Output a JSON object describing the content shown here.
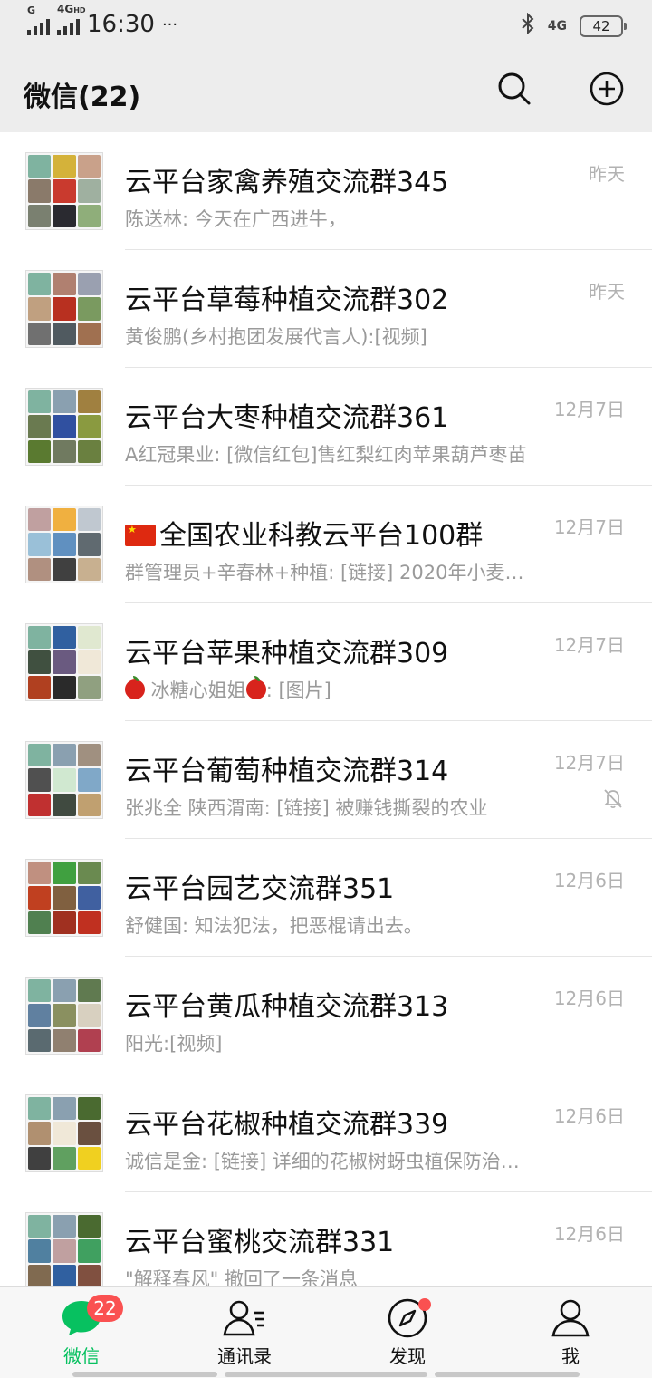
{
  "status_bar": {
    "signal_label": "G",
    "net_label": "4G",
    "net_sub": "HD",
    "time": "16:30",
    "more": "···",
    "right_net": "4G",
    "battery": "42"
  },
  "header": {
    "title": "微信(22)"
  },
  "chats": [
    {
      "name": "云平台家禽养殖交流群345",
      "message": "陈送林: 今天在广西进牛，",
      "time": "昨天",
      "muted": false,
      "avatar": [
        "#7fb3a0",
        "#d4b23a",
        "#c9a18a",
        "#8a7a6a",
        "#c93a2e",
        "#9fb0a0",
        "#7a8070",
        "#2a2a30",
        "#8fae7a"
      ]
    },
    {
      "name": "云平台草莓种植交流群302",
      "message": "黄俊鹏(乡村抱团发展代言人):[视频]",
      "time": "昨天",
      "muted": false,
      "avatar": [
        "#7fb3a0",
        "#b08070",
        "#9aa0b0",
        "#c0a080",
        "#b83020",
        "#7a9a60",
        "#707070",
        "#505a60",
        "#a07050"
      ]
    },
    {
      "name": "云平台大枣种植交流群361",
      "message": "A红冠果业: [微信红包]售红梨红肉苹果葫芦枣苗",
      "time": "12月7日",
      "muted": false,
      "avatar": [
        "#7fb3a0",
        "#8aa0b0",
        "#a08040",
        "#6a7a50",
        "#3050a0",
        "#8a9a40",
        "#5a7a30",
        "#707a60",
        "#6a8040"
      ]
    },
    {
      "name_prefix_flag": true,
      "name": "全国农业科教云平台100群",
      "message": "群管理员+辛春林+种植: [链接] 2020年小麦…",
      "time": "12月7日",
      "muted": false,
      "avatar": [
        "#c0a0a0",
        "#f0b040",
        "#c0c8d0",
        "#9ac0d8",
        "#6090c0",
        "#606a70",
        "#b09080",
        "#404040",
        "#c8b090"
      ]
    },
    {
      "name": "云平台苹果种植交流群309",
      "message_prefix_apple": true,
      "message": " 冰糖心姐姐",
      "message_mid_apple": true,
      "message_tail": ": [图片]",
      "time": "12月7日",
      "muted": false,
      "avatar": [
        "#7fb3a0",
        "#3060a0",
        "#e0e8d0",
        "#405040",
        "#6a5a80",
        "#f0e8d8",
        "#b04020",
        "#2a2a2a",
        "#90a080"
      ]
    },
    {
      "name": "云平台葡萄种植交流群314",
      "message": "张兆全 陕西渭南: [链接] 被赚钱撕裂的农业",
      "time": "12月7日",
      "muted": true,
      "avatar": [
        "#7fb3a0",
        "#8aa0b0",
        "#a09080",
        "#505050",
        "#d0e8d0",
        "#80a8c8",
        "#c03030",
        "#404a40",
        "#c0a070"
      ]
    },
    {
      "name": "云平台园艺交流群351",
      "message": "舒健国: 知法犯法，把恶棍请出去。",
      "time": "12月6日",
      "muted": false,
      "avatar": [
        "#c09080",
        "#40a040",
        "#6a8a50",
        "#c04020",
        "#806040",
        "#4060a0",
        "#508050",
        "#a03020",
        "#c03020"
      ]
    },
    {
      "name": "云平台黄瓜种植交流群313",
      "message": "阳光:[视频]",
      "time": "12月6日",
      "muted": false,
      "avatar": [
        "#7fb3a0",
        "#8aa0b0",
        "#607a50",
        "#6080a0",
        "#8a9060",
        "#d8d0c0",
        "#5a6a70",
        "#908070",
        "#b04050"
      ]
    },
    {
      "name": "云平台花椒种植交流群339",
      "message": "诚信是金: [链接] 详细的花椒树蚜虫植保防治…",
      "time": "12月6日",
      "muted": false,
      "avatar": [
        "#7fb3a0",
        "#8aa0b0",
        "#4a6a30",
        "#b09070",
        "#f0e8d8",
        "#6a5040",
        "#404040",
        "#60a060",
        "#f0d020"
      ]
    },
    {
      "name": "云平台蜜桃交流群331",
      "message": "\"解释春风\" 撤回了一条消息",
      "time": "12月6日",
      "muted": false,
      "avatar": [
        "#7fb3a0",
        "#8aa0b0",
        "#4a6a30",
        "#5080a0",
        "#c0a0a0",
        "#40a060",
        "#806a50",
        "#3060a0",
        "#805040"
      ]
    }
  ],
  "tabs": [
    {
      "label": "微信",
      "badge": "22",
      "active": true,
      "icon": "chat-bubble-icon"
    },
    {
      "label": "通讯录",
      "active": false,
      "icon": "contacts-icon"
    },
    {
      "label": "发现",
      "active": false,
      "dot": true,
      "icon": "compass-icon"
    },
    {
      "label": "我",
      "active": false,
      "icon": "person-icon"
    }
  ],
  "colors": {
    "accent": "#07c160",
    "badge": "#fa5151",
    "bg": "#ededed"
  }
}
